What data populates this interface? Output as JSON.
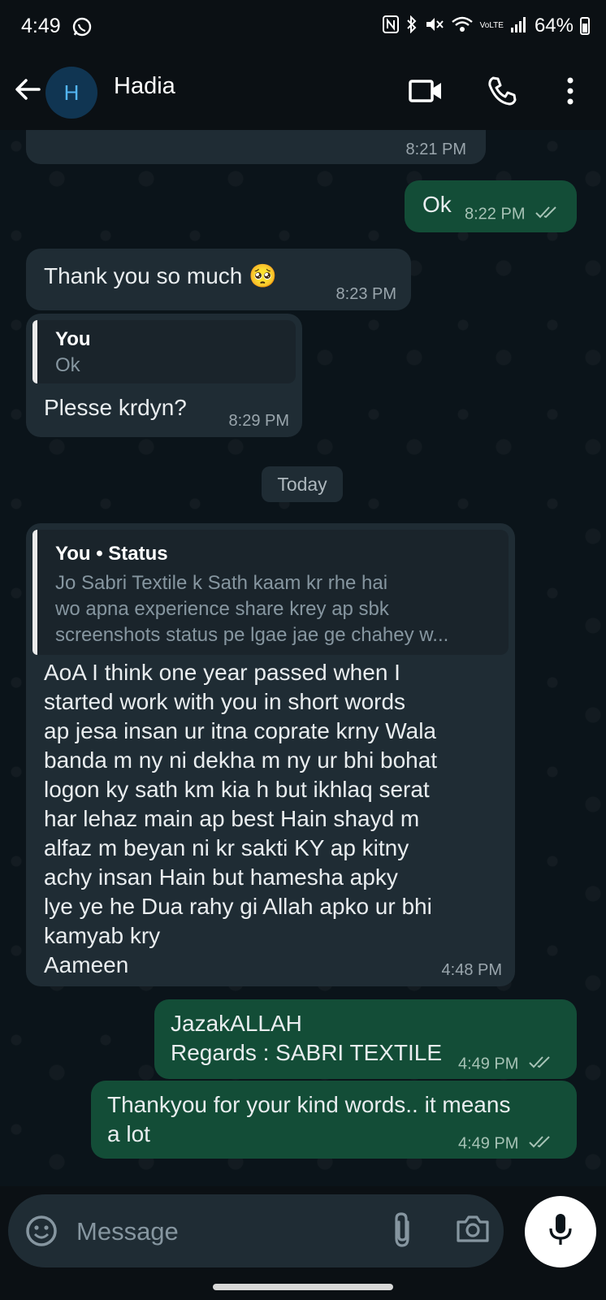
{
  "status_bar": {
    "time": "4:49",
    "battery": "64%",
    "network": "VoLTE"
  },
  "header": {
    "contact_initial": "H",
    "contact_name": "Hadia"
  },
  "messages": [
    {
      "dir": "in",
      "text": "",
      "time": "8:21 PM"
    },
    {
      "dir": "out",
      "text": "Ok",
      "time": "8:22 PM"
    },
    {
      "dir": "in",
      "text": "Thank you so much 🥺",
      "time": "8:23 PM"
    },
    {
      "dir": "in",
      "quote_author": "You",
      "quote_text": "Ok",
      "text": "Plesse krdyn?",
      "time": "8:29 PM"
    },
    {
      "dir": "in",
      "quote_author": "You • Status",
      "quote_text": "Jo Sabri Textile k Sath kaam kr rhe hai\nwo apna experience share krey ap sbk\nscreenshots status pe lgae jae ge chahey w...",
      "text": "AoA I think one year passed when I\nstarted work with you in short words\nap jesa insan ur itna coprate krny Wala\nbanda m ny ni dekha m ny ur bhi bohat\nlogon ky sath km kia h but ikhlaq serat\nhar lehaz main ap best Hain shayd m\nalfaz m beyan ni kr sakti KY ap kitny\nachy insan Hain but hamesha apky\nlye ye he Dua rahy gi Allah apko ur bhi\nkamyab kry\nAameen",
      "time": "4:48 PM"
    },
    {
      "dir": "out",
      "text": "JazakALLAH\nRegards : SABRI TEXTILE",
      "time": "4:49 PM"
    },
    {
      "dir": "out",
      "text": "Thankyou for your kind words.. it means\na lot",
      "time": "4:49 PM"
    }
  ],
  "date_separator": "Today",
  "input": {
    "placeholder": "Message",
    "value": ""
  },
  "icons": [
    "back-arrow-icon",
    "video-call-icon",
    "phone-icon",
    "more-icon",
    "emoji-icon",
    "attach-icon",
    "camera-icon",
    "mic-icon",
    "double-check-icon",
    "whatsapp-icon"
  ],
  "colors": {
    "background": "#0b141a",
    "incoming_bubble": "#1f2c34",
    "outgoing_bubble": "#134d37",
    "avatar_bg": "#103552",
    "avatar_text": "#53b6f5"
  }
}
